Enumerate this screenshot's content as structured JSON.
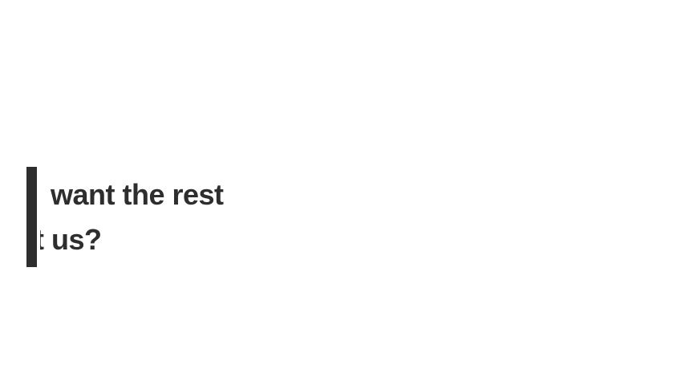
{
  "caption": {
    "line_1": "want the rest",
    "line_2": "t us?"
  },
  "colors": {
    "text": "#2e2e2e",
    "accent_bar": "#2e2e2e",
    "background": "#ffffff"
  }
}
